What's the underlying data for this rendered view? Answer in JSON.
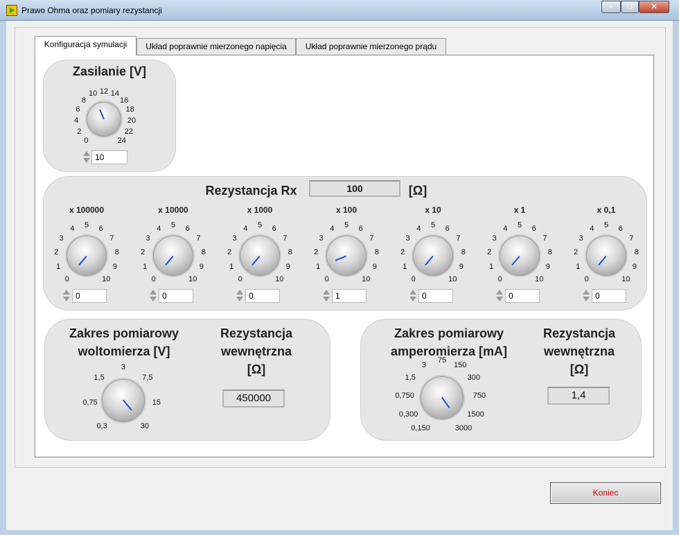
{
  "window": {
    "title": "Prawo Ohma oraz pomiary rezystancji",
    "min_glyph": "–",
    "max_glyph": "□",
    "close_glyph": "✕"
  },
  "tabs": [
    {
      "label": "Konfiguracja symulacji",
      "active": true
    },
    {
      "label": "Układ poprawnie mierzonego napięcia",
      "active": false
    },
    {
      "label": "Układ poprawnie mierzonego prądu",
      "active": false
    }
  ],
  "zasilanie": {
    "title": "Zasilanie [V]",
    "scale": [
      "0",
      "2",
      "4",
      "6",
      "8",
      "10",
      "12",
      "14",
      "16",
      "18",
      "20",
      "22",
      "24"
    ],
    "value": "10"
  },
  "rezystancja": {
    "title": "Rezystancja Rx",
    "display_value": "100",
    "unit": "[Ω]",
    "decade_scale": [
      "0",
      "1",
      "2",
      "3",
      "4",
      "5",
      "6",
      "7",
      "8",
      "9",
      "10"
    ],
    "decades": [
      {
        "label": "x 100000",
        "value": "0"
      },
      {
        "label": "x 10000",
        "value": "0"
      },
      {
        "label": "x 1000",
        "value": "0"
      },
      {
        "label": "x 100",
        "value": "1"
      },
      {
        "label": "x 10",
        "value": "0"
      },
      {
        "label": "x 1",
        "value": "0"
      },
      {
        "label": "x 0,1",
        "value": "0"
      }
    ]
  },
  "woltomierz": {
    "range_title_1": "Zakres pomiarowy",
    "range_title_2": "woltomierza [V]",
    "scale": [
      "0,3",
      "0,75",
      "1,5",
      "3",
      "7,5",
      "15",
      "30"
    ],
    "selected": "30",
    "res_title_1": "Rezystancja",
    "res_title_2": "wewnętrzna",
    "res_title_3": "[Ω]",
    "res_value": "450000"
  },
  "amperomierz": {
    "range_title_1": "Zakres pomiarowy",
    "range_title_2": "amperomierza [mA]",
    "scale": [
      "0,150",
      "0,300",
      "0,750",
      "1,5",
      "3",
      "75",
      "150",
      "300",
      "750",
      "1500",
      "3000"
    ],
    "selected": "3000",
    "res_title_1": "Rezystancja",
    "res_title_2": "wewnętrzna",
    "res_title_3": "[Ω]",
    "res_value": "1,4"
  },
  "end_button": {
    "label": "Koniec",
    "color": "#dd0000"
  },
  "colors": {
    "needle": "#1f4fd8",
    "group_bg": "#e6e6e6"
  }
}
